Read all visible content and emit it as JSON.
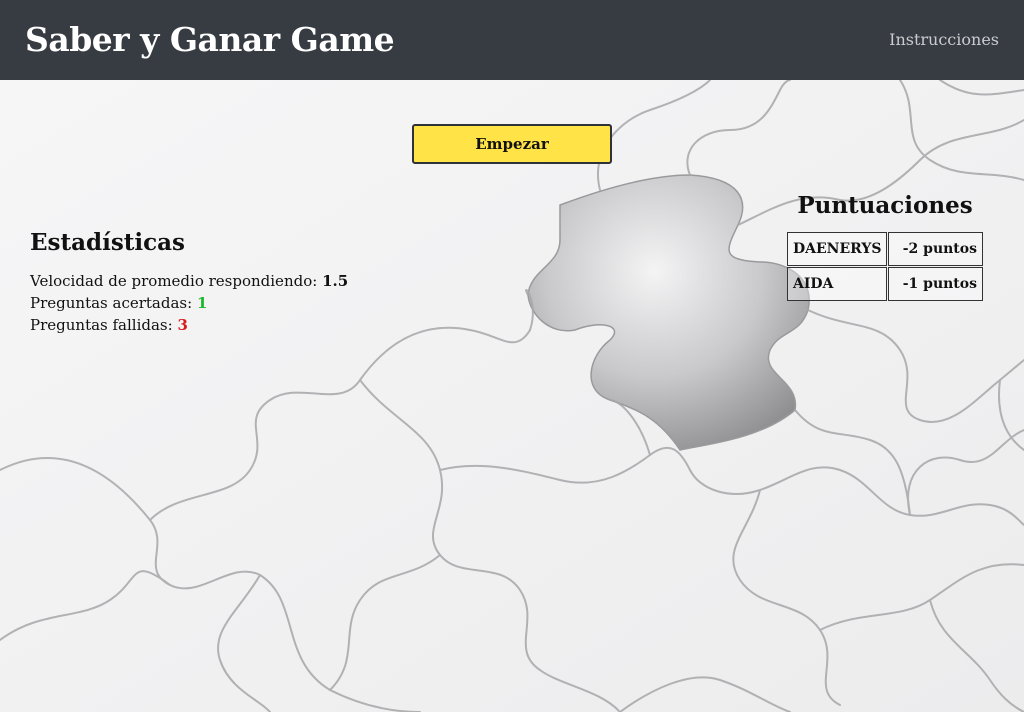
{
  "header": {
    "brand": "Saber y Ganar Game",
    "nav_instructions": "Instrucciones"
  },
  "main": {
    "start_label": "Empezar",
    "stats": {
      "title": "Estadísticas",
      "speed_label": "Velocidad de promedio respondiendo:",
      "speed_value": "1.5",
      "correct_label": "Preguntas acertadas:",
      "correct_value": "1",
      "wrong_label": "Preguntas fallidas:",
      "wrong_value": "3"
    },
    "scores": {
      "title": "Puntuaciones",
      "rows": [
        {
          "name": "DAENERYS",
          "points": "-2 puntos"
        },
        {
          "name": "AIDA",
          "points": "-1 puntos"
        }
      ]
    }
  },
  "colors": {
    "header_bg": "#373b42",
    "button_bg": "#ffe347",
    "correct": "#1cb82a",
    "wrong": "#d71d1d"
  }
}
